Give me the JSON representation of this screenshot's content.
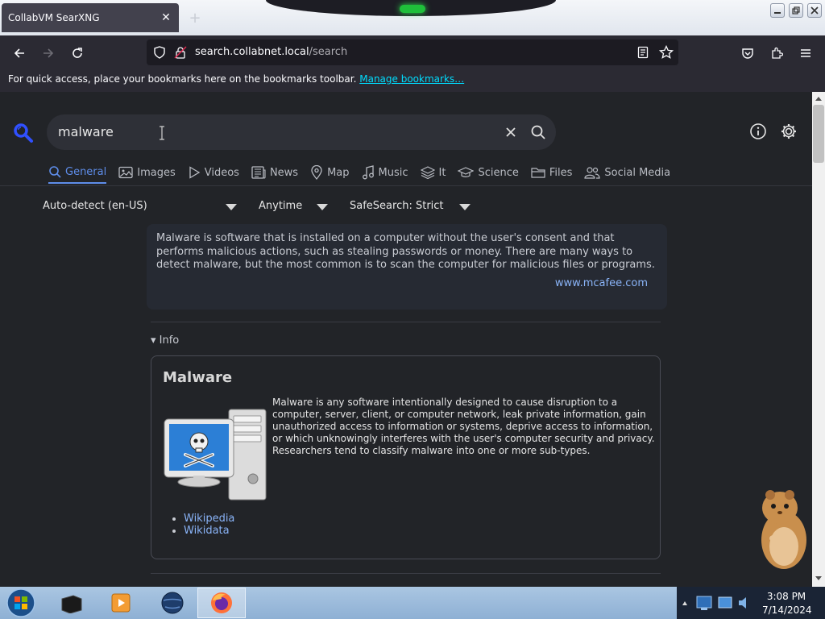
{
  "window": {
    "tab_title": "CollabVM SearXNG",
    "tab_close": "✕",
    "new_tab": "+"
  },
  "navbar": {
    "url_host": "search.collabnet.local",
    "url_path": "/search"
  },
  "bookmarks": {
    "message": "For quick access, place your bookmarks here on the bookmarks toolbar.",
    "manage_link": "Manage bookmarks…"
  },
  "search": {
    "query": "malware"
  },
  "categories": [
    {
      "label": "General",
      "icon": "search-icon",
      "active": true
    },
    {
      "label": "Images",
      "icon": "image-icon"
    },
    {
      "label": "Videos",
      "icon": "play-icon"
    },
    {
      "label": "News",
      "icon": "newspaper-icon"
    },
    {
      "label": "Map",
      "icon": "map-pin-icon"
    },
    {
      "label": "Music",
      "icon": "music-note-icon"
    },
    {
      "label": "It",
      "icon": "layers-icon"
    },
    {
      "label": "Science",
      "icon": "graduation-cap-icon"
    },
    {
      "label": "Files",
      "icon": "folder-icon"
    },
    {
      "label": "Social Media",
      "icon": "people-icon"
    }
  ],
  "filters": {
    "language": "Auto-detect (en-US)",
    "time": "Anytime",
    "safesearch": "SafeSearch: Strict"
  },
  "answer": {
    "text": "Malware is software that is installed on a computer without the user's consent and that performs malicious actions, such as stealing passwords or money. There are many ways to detect malware, but the most common is to scan the computer for malicious files or programs.",
    "source": "www.mcafee.com"
  },
  "infobox": {
    "section_label": "▾ Info",
    "title": "Malware",
    "description": "Malware is any software intentionally designed to cause disruption to a computer, server, client, or computer network, leak private information, gain unauthorized access to information or systems, deprive access to information, or which unknowingly interferes with the user's computer security and privacy. Researchers tend to classify malware into one or more sub-types.",
    "links": [
      "Wikipedia",
      "Wikidata"
    ]
  },
  "taskbar": {
    "time": "3:08 PM",
    "date": "7/14/2024"
  },
  "colors": {
    "accent": "#5e8dea",
    "link": "#8ab4f8",
    "page_bg": "#222428",
    "toolbar_bg": "#2b2a33"
  }
}
